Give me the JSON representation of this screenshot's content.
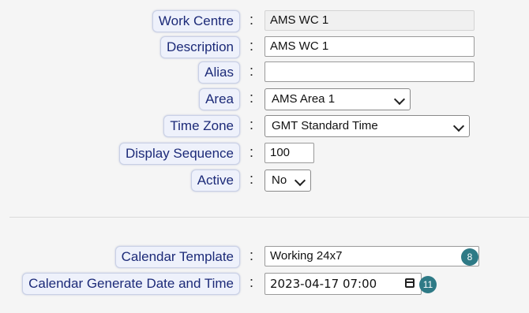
{
  "form": {
    "work_centre": {
      "label": "Work Centre",
      "value": "AMS WC 1"
    },
    "description": {
      "label": "Description",
      "value": "AMS WC 1"
    },
    "alias": {
      "label": "Alias",
      "value": ""
    },
    "area": {
      "label": "Area",
      "value": "AMS Area 1"
    },
    "time_zone": {
      "label": "Time Zone",
      "value": "GMT Standard Time"
    },
    "display_sequence": {
      "label": "Display Sequence",
      "value": "100"
    },
    "active": {
      "label": "Active",
      "value": "No"
    },
    "calendar_template": {
      "label": "Calendar Template",
      "value": "Working 24x7",
      "badge": "8"
    },
    "calendar_generate": {
      "label": "Calendar Generate Date and Time",
      "value": "2023-04-17 07:00",
      "badge": "11"
    }
  },
  "separator": ":",
  "colors": {
    "label_text": "#1c2a78",
    "badge": "#2e7a86"
  },
  "icons": {
    "dropdown": "chevron-down-icon",
    "date_picker": "calendar-icon"
  }
}
